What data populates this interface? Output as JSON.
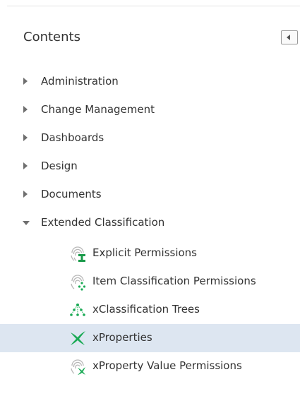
{
  "panel": {
    "title": "Contents",
    "collapse_icon": "collapse-left-icon"
  },
  "tree": {
    "items": [
      {
        "label": "Administration",
        "expanded": false
      },
      {
        "label": "Change Management",
        "expanded": false
      },
      {
        "label": "Dashboards",
        "expanded": false
      },
      {
        "label": "Design",
        "expanded": false
      },
      {
        "label": "Documents",
        "expanded": false
      },
      {
        "label": "Extended Classification",
        "expanded": true,
        "children": [
          {
            "label": "Explicit Permissions",
            "icon": "fingerprint-permission-icon"
          },
          {
            "label": "Item Classification Permissions",
            "icon": "fingerprint-tree-icon"
          },
          {
            "label": "xClassification Trees",
            "icon": "classification-tree-icon"
          },
          {
            "label": "xProperties",
            "icon": "xproperty-icon",
            "selected": true
          },
          {
            "label": "xProperty Value Permissions",
            "icon": "fingerprint-x-icon"
          }
        ]
      }
    ]
  },
  "colors": {
    "selected_background": "#dde6f1",
    "icon_green": "#1aaa55"
  }
}
